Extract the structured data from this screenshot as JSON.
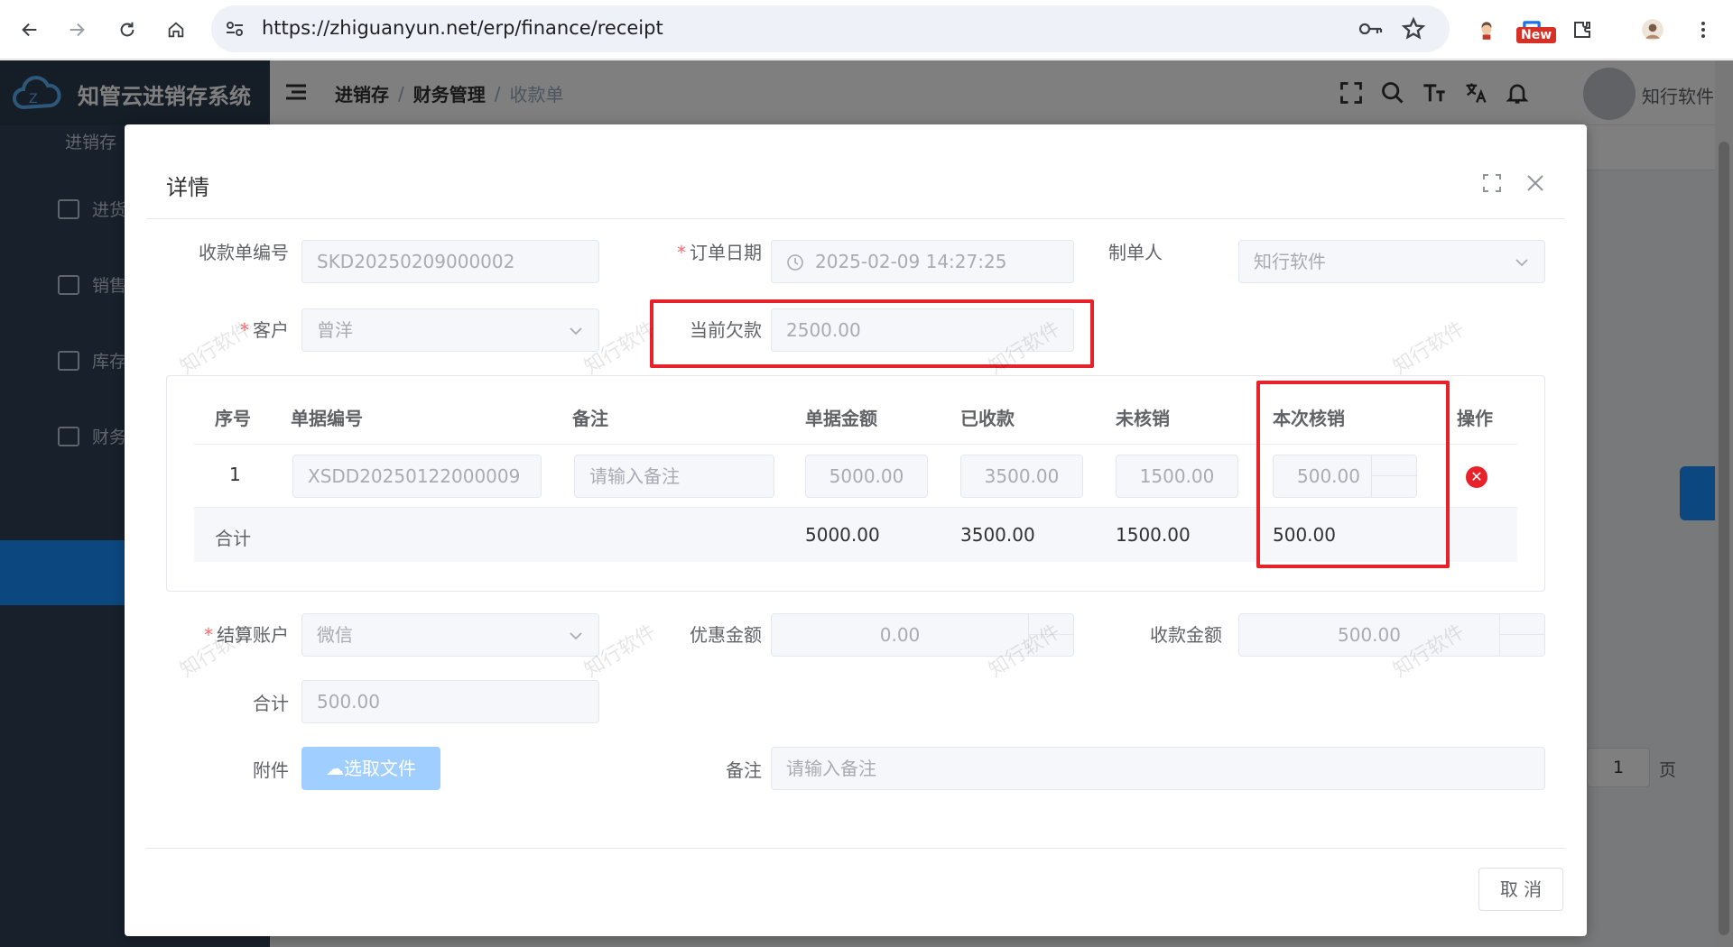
{
  "browser": {
    "url": "https://zhiguanyun.net/erp/finance/receipt",
    "new_badge": "New"
  },
  "app": {
    "logo_text": "知管云进销存系统",
    "sidebar": {
      "items": [
        {
          "label": "进销存"
        },
        {
          "label": "进货"
        },
        {
          "label": "销售"
        },
        {
          "label": "库存"
        },
        {
          "label": "财务"
        }
      ]
    },
    "breadcrumb": [
      "进销存",
      "财务管理",
      "收款单"
    ],
    "user_name": "知行软件",
    "pager": {
      "page": "1",
      "label": "页"
    }
  },
  "dialog": {
    "title": "详情",
    "watermark": "知行软件",
    "fields": {
      "receipt_no": {
        "label": "收款单编号",
        "value": "SKD20250209000002"
      },
      "order_date": {
        "label": "订单日期",
        "value": "2025-02-09 14:27:25"
      },
      "creator": {
        "label": "制单人",
        "value": "知行软件"
      },
      "customer": {
        "label": "客户",
        "value": "曾洋"
      },
      "current_debt": {
        "label": "当前欠款",
        "value": "2500.00"
      },
      "settle_account": {
        "label": "结算账户",
        "value": "微信"
      },
      "discount": {
        "label": "优惠金额",
        "value": "0.00"
      },
      "receipt_amount": {
        "label": "收款金额",
        "value": "500.00"
      },
      "total": {
        "label": "合计",
        "value": "500.00"
      },
      "attachment": {
        "label": "附件",
        "button": "选取文件"
      },
      "remark": {
        "label": "备注",
        "placeholder": "请输入备注"
      }
    },
    "table": {
      "headers": [
        "序号",
        "单据编号",
        "备注",
        "单据金额",
        "已收款",
        "未核销",
        "本次核销",
        "操作"
      ],
      "rows": [
        {
          "index": "1",
          "doc_no": "XSDD20250122000009",
          "remark_placeholder": "请输入备注",
          "doc_amount": "5000.00",
          "received": "3500.00",
          "unsettled": "1500.00",
          "this_settle": "500.00"
        }
      ],
      "summary": {
        "label": "合计",
        "doc_amount": "5000.00",
        "received": "3500.00",
        "unsettled": "1500.00",
        "this_settle": "500.00"
      }
    },
    "cancel_label": "取 消"
  },
  "colors": {
    "highlight_box": "#e8222a",
    "primary": "#1890ff",
    "sidebar": "#304156"
  }
}
